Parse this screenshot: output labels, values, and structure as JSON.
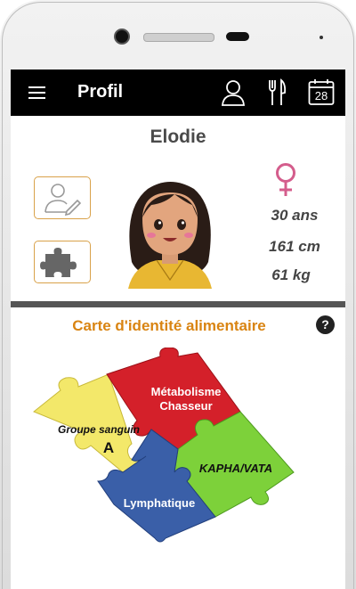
{
  "appbar": {
    "title": "Profil",
    "calendar_day": "28"
  },
  "profile": {
    "name": "Elodie",
    "age": "30 ans",
    "height": "161 cm",
    "weight": "61 kg",
    "gender_symbol": "♀"
  },
  "identity_card": {
    "title": "Carte d'identité alimentaire",
    "help": "?",
    "pieces": {
      "blood_group_label": "Groupe sanguin",
      "blood_group_value": "A",
      "metabolism_line1": "Métabolisme",
      "metabolism_line2": "Chasseur",
      "dosha": "KAPHA/VATA",
      "lymph": "Lymphatique"
    }
  },
  "colors": {
    "appbar": "#000000",
    "accent_orange": "#d98412",
    "gender_pink": "#d45d8c",
    "piece_yellow": "#f3e86a",
    "piece_red": "#d4202a",
    "piece_green": "#7dd13a",
    "piece_blue": "#3a5fa8"
  },
  "icons": [
    "menu-icon",
    "user-outline-icon",
    "cutlery-icon",
    "calendar-icon",
    "edit-profile-icon",
    "puzzle-icon",
    "help-icon",
    "female-icon"
  ]
}
